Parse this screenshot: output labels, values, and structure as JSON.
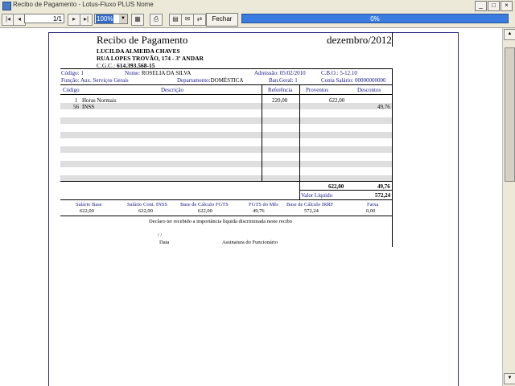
{
  "window": {
    "title": "Recibo de Pagamento - Lotus-Fluxo PLUS Nome",
    "minimize": "_",
    "maximize": "□",
    "close": "×"
  },
  "toolbar": {
    "page_value": "1/1",
    "zoom_value": "100%",
    "close_label": "Fechar",
    "progress_text": "0%",
    "progress_fraction": 0
  },
  "receipt": {
    "title": "Recibo de Pagamento",
    "period": "dezembro/2012",
    "employer_name": "LUCILDA ALMEIDA CHAVES",
    "employer_address": "RUA LOPES TROVÃO, 174 - 3º ANDAR",
    "cgc_label": "C.G.C.:",
    "cgc_value": "614.393.568-15",
    "codigo_label": "Código:",
    "codigo_value": "1",
    "nome_label": "Nome:",
    "nome_value": "ROSELIA DA SILVA",
    "admissao_label": "Admissão:",
    "admissao_value": "05/02/2010",
    "cbo_label": "C.B.O.:",
    "cbo_value": "5-12.10",
    "funcao_label": "Função:",
    "funcao_value": "Aux. Serviços Gerais",
    "departamento_label": "Departamento:",
    "departamento_value": "DOMÉSTICA",
    "bancario_label": "Ban.Geral:",
    "bancario_value": "1",
    "conta_label": "Conta Salário:",
    "conta_value": "00000000000",
    "headers": {
      "codigo": "Código",
      "descricao": "Descrição",
      "referencia": "Referência",
      "proventos": "Proventos",
      "descontos": "Descontos"
    },
    "items": [
      {
        "codigo": "1",
        "descricao": "Horas Normais",
        "referencia": "220,00",
        "proventos": "622,00",
        "descontos": ""
      },
      {
        "codigo": "56",
        "descricao": "INSS",
        "referencia": "",
        "proventos": "",
        "descontos": "49,76"
      }
    ],
    "total_proventos": "622,00",
    "total_descontos": "49,76",
    "valor_liquido_label": "Valor Líquido",
    "valor_liquido_value": "572,24",
    "bases": [
      {
        "label": "Salário Base",
        "value": "622,00"
      },
      {
        "label": "Salário Cont. INSS",
        "value": "622,00"
      },
      {
        "label": "Base de Cálculo FGTS",
        "value": "622,00"
      },
      {
        "label": "FGTS do Mês",
        "value": "49,76"
      },
      {
        "label": "Base de Cálculo IRRF",
        "value": "572,24"
      },
      {
        "label": "Faixa",
        "value": "0,00"
      }
    ],
    "declaration": "Declaro ter recebido a importância líquida discriminada neste recibo",
    "date_slashes": "/        /",
    "data_label": "Data",
    "assinatura_label": "Assinatura do Funcionário"
  }
}
